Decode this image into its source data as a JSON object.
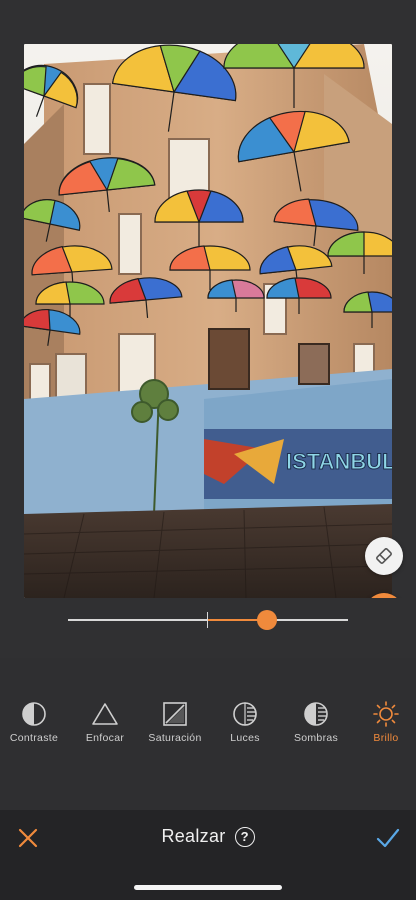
{
  "app": {
    "screen_title": "Realzar",
    "help_symbol": "?"
  },
  "adjustment": {
    "value": 0.42,
    "active_tool": "Brillo"
  },
  "tools": [
    {
      "label": "Contraste",
      "icon": "contrast-icon"
    },
    {
      "label": "Enfocar",
      "icon": "sharpen-triangle-icon"
    },
    {
      "label": "Saturación",
      "icon": "saturation-icon"
    },
    {
      "label": "Luces",
      "icon": "highlights-icon"
    },
    {
      "label": "Sombras",
      "icon": "shadows-icon"
    },
    {
      "label": "Brillo",
      "icon": "brightness-sun-icon"
    }
  ],
  "colors": {
    "accent": "#f08a3c",
    "background": "#303032",
    "bottom_bar": "#242426",
    "confirm": "#5aa8e6"
  },
  "photo": {
    "signage_text": "ISTANBUL"
  }
}
